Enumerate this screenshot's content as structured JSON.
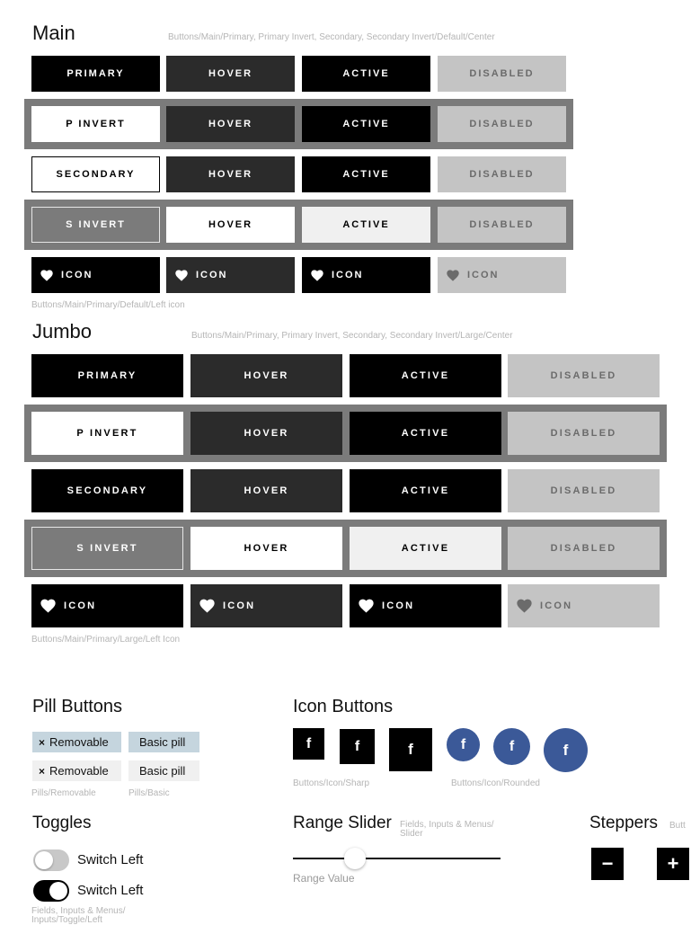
{
  "main": {
    "title": "Main",
    "path": "Buttons/Main/Primary, Primary Invert, Secondary, Secondary Invert/Default/Center",
    "rows": [
      [
        "PRIMARY",
        "HOVER",
        "ACTIVE",
        "DISABLED"
      ],
      [
        "P INVERT",
        "HOVER",
        "ACTIVE",
        "DISABLED"
      ],
      [
        "SECONDARY",
        "HOVER",
        "ACTIVE",
        "DISABLED"
      ],
      [
        "S INVERT",
        "HOVER",
        "ACTIVE",
        "DISABLED"
      ],
      [
        "ICON",
        "ICON",
        "ICON",
        "ICON"
      ]
    ],
    "icon_path": "Buttons/Main/Primary/Default/Left icon"
  },
  "jumbo": {
    "title": "Jumbo",
    "path": "Buttons/Main/Primary, Primary Invert, Secondary, Secondary Invert/Large/Center",
    "rows": [
      [
        "PRIMARY",
        "HOVER",
        "ACTIVE",
        "DISABLED"
      ],
      [
        "P INVERT",
        "HOVER",
        "ACTIVE",
        "DISABLED"
      ],
      [
        "SECONDARY",
        "HOVER",
        "ACTIVE",
        "DISABLED"
      ],
      [
        "S INVERT",
        "HOVER",
        "ACTIVE",
        "DISABLED"
      ],
      [
        "ICON",
        "ICON",
        "ICON",
        "ICON"
      ]
    ],
    "icon_path": "Buttons/Main/Primary/Large/Left Icon"
  },
  "pills": {
    "title": "Pill Buttons",
    "removable_label": "Removable",
    "remove_glyph": "×",
    "basic_label": "Basic pill",
    "removable_path": "Pills/Removable",
    "basic_path": "Pills/Basic",
    "selected_color": "#c5d5de",
    "default_color": "#f0f0f0"
  },
  "icon_buttons": {
    "title": "Icon Buttons",
    "glyph": "f",
    "icon": "facebook-icon",
    "sharp_path": "Buttons/Icon/Sharp",
    "rounded_path": "Buttons/Icon/Rounded",
    "brand_color": "#3b5998"
  },
  "toggles": {
    "title": "Toggles",
    "items": [
      {
        "label": "Switch Left",
        "on": false
      },
      {
        "label": "Switch Left",
        "on": true
      }
    ],
    "path": "Fields, Inputs & Menus/\nInputs/Toggle/Left"
  },
  "range": {
    "title": "Range Slider",
    "path": "Fields, Inputs & Menus/\nSlider",
    "value_label": "Range Value",
    "value_fraction": 0.3
  },
  "steppers": {
    "title": "Steppers",
    "path": "Butt",
    "minus": "−",
    "plus": "+"
  }
}
